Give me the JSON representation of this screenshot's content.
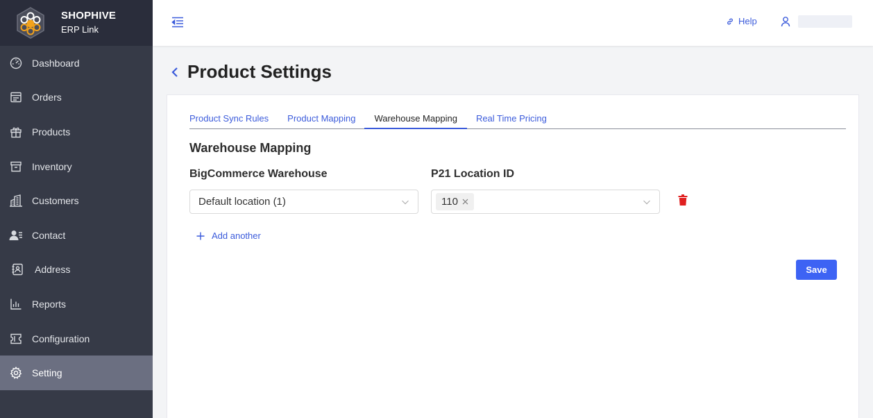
{
  "brand": {
    "name": "SHOPHIVE",
    "subtitle": "ERP Link"
  },
  "sidebar": {
    "items": [
      {
        "label": "Dashboard",
        "icon": "dashboard-icon"
      },
      {
        "label": "Orders",
        "icon": "orders-icon"
      },
      {
        "label": "Products",
        "icon": "gift-icon"
      },
      {
        "label": "Inventory",
        "icon": "box-icon"
      },
      {
        "label": "Customers",
        "icon": "building-icon"
      },
      {
        "label": "Contact",
        "icon": "contact-icon"
      },
      {
        "label": "Address",
        "icon": "address-book-icon"
      },
      {
        "label": "Reports",
        "icon": "bar-chart-icon"
      },
      {
        "label": "Configuration",
        "icon": "configuration-icon"
      },
      {
        "label": "Setting",
        "icon": "gear-icon",
        "active": true
      }
    ]
  },
  "topbar": {
    "help_label": "Help"
  },
  "page": {
    "title": "Product Settings"
  },
  "tabs": [
    {
      "label": "Product Sync Rules"
    },
    {
      "label": "Product Mapping"
    },
    {
      "label": "Warehouse Mapping",
      "active": true
    },
    {
      "label": "Real Time Pricing"
    }
  ],
  "warehouse": {
    "title": "Warehouse Mapping",
    "bigcommerce_label": "BigCommerce Warehouse",
    "p21_label": "P21 Location ID",
    "rows": [
      {
        "bigcommerce_value": "Default location (1)",
        "p21_tags": [
          "110"
        ]
      }
    ],
    "add_label": "Add another",
    "save_label": "Save"
  },
  "colors": {
    "accent": "#3d63f4",
    "link": "#3b5bdb",
    "sidebar": "#363a47",
    "active_item": "#6b6f81",
    "delete": "#e02020"
  }
}
